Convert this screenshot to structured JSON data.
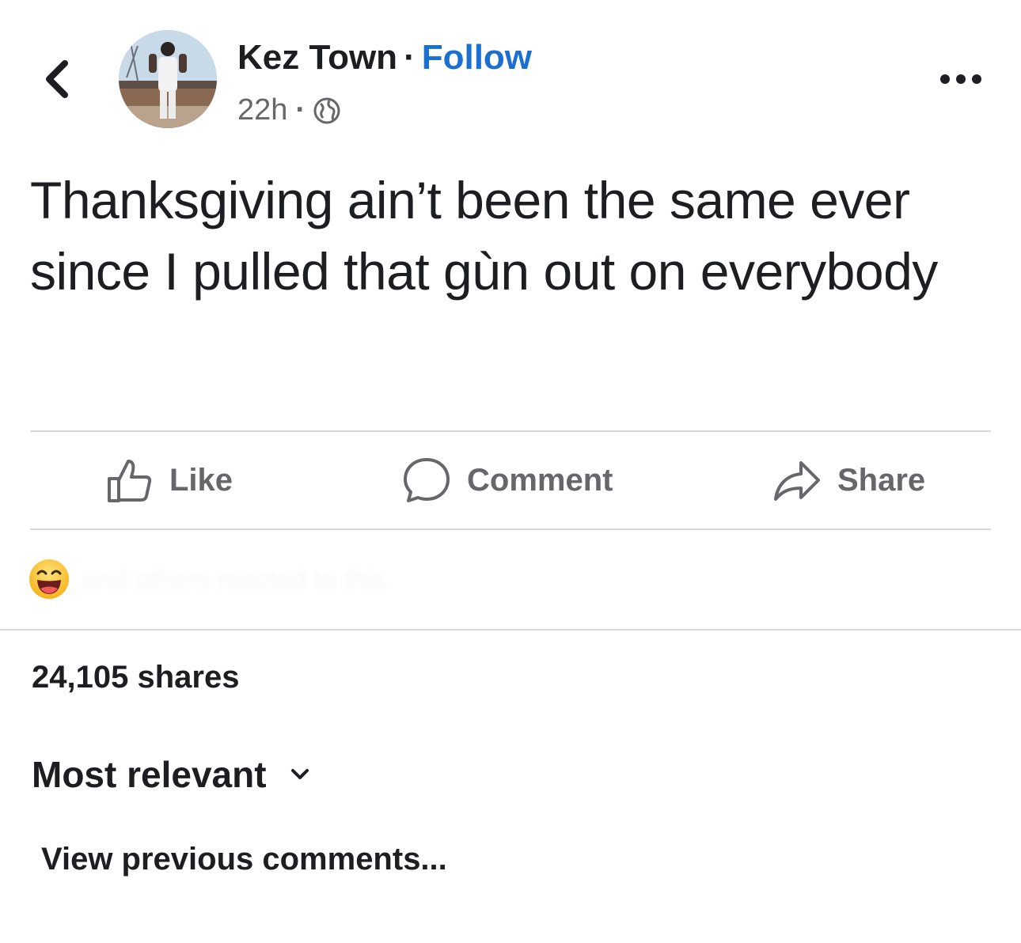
{
  "header": {
    "author_name": "Kez Town",
    "separator": "·",
    "follow_label": "Follow",
    "timestamp": "22h",
    "meta_separator": "·",
    "audience_icon": "globe-icon",
    "back_icon": "chevron-left-icon",
    "more_icon": "more-dots-icon"
  },
  "post": {
    "text": "Thanksgiving ain’t been the same ever since I pulled that gùn out on everybody"
  },
  "actions": {
    "like_label": "Like",
    "comment_label": "Comment",
    "share_label": "Share"
  },
  "reactions": {
    "emoji_icon": "laughing-emoji-icon",
    "summary_text": "and others reacted to this"
  },
  "stats": {
    "shares_text": "24,105 shares"
  },
  "comments": {
    "sort_label": "Most relevant",
    "view_previous_label": "View previous comments..."
  },
  "colors": {
    "follow_blue": "#1b6fd1",
    "secondary_gray": "#65676b",
    "divider": "#d6d8db"
  }
}
